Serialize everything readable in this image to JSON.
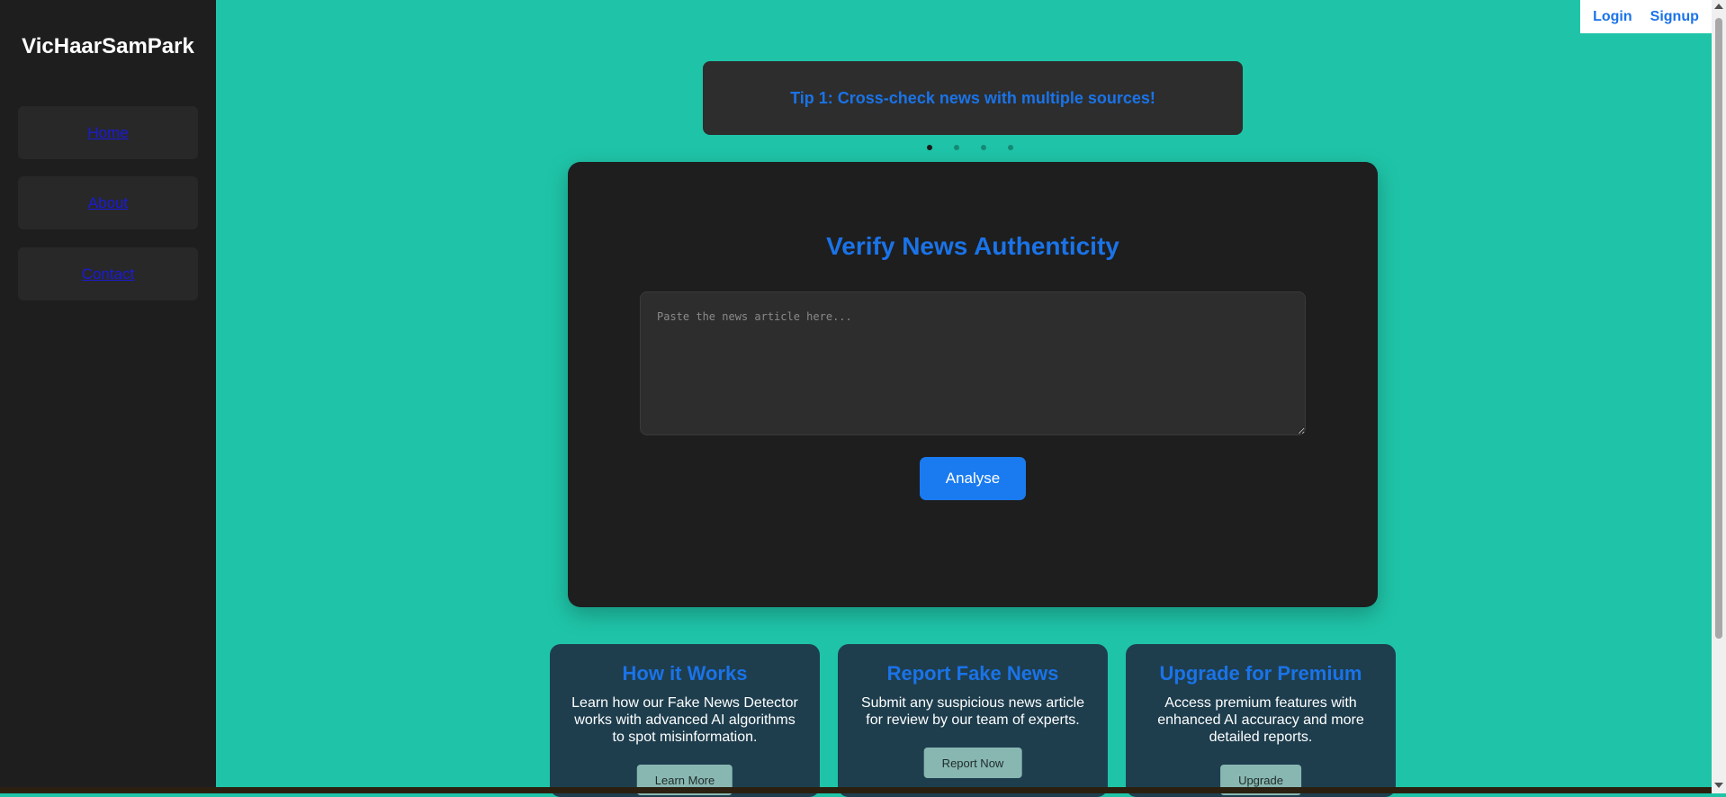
{
  "sidebar": {
    "brand": "VicHaarSamPark",
    "items": [
      {
        "label": "Home"
      },
      {
        "label": "About"
      },
      {
        "label": "Contact"
      }
    ]
  },
  "auth": {
    "login": "Login",
    "signup": "Signup"
  },
  "tips": {
    "current": "Tip 1: Cross-check news with multiple sources!",
    "count": 4,
    "active_index": 0
  },
  "verify": {
    "title": "Verify News Authenticity",
    "placeholder": "Paste the news article here...",
    "value": "",
    "analyse_label": "Analyse"
  },
  "features": [
    {
      "title": "How it Works",
      "description": "Learn how our Fake News Detector works with advanced AI algorithms to spot misinformation.",
      "button": "Learn More"
    },
    {
      "title": "Report Fake News",
      "description": "Submit any suspicious news article for review by our team of experts.",
      "button": "Report Now"
    },
    {
      "title": "Upgrade for Premium",
      "description": "Access premium features with enhanced AI accuracy and more detailed reports.",
      "button": "Upgrade"
    }
  ],
  "colors": {
    "background": "#1fc4a8",
    "sidebar": "#1e1e1e",
    "accent": "#1a73e8",
    "card": "#1e1e1e",
    "feature_card": "#1e3e4e"
  }
}
